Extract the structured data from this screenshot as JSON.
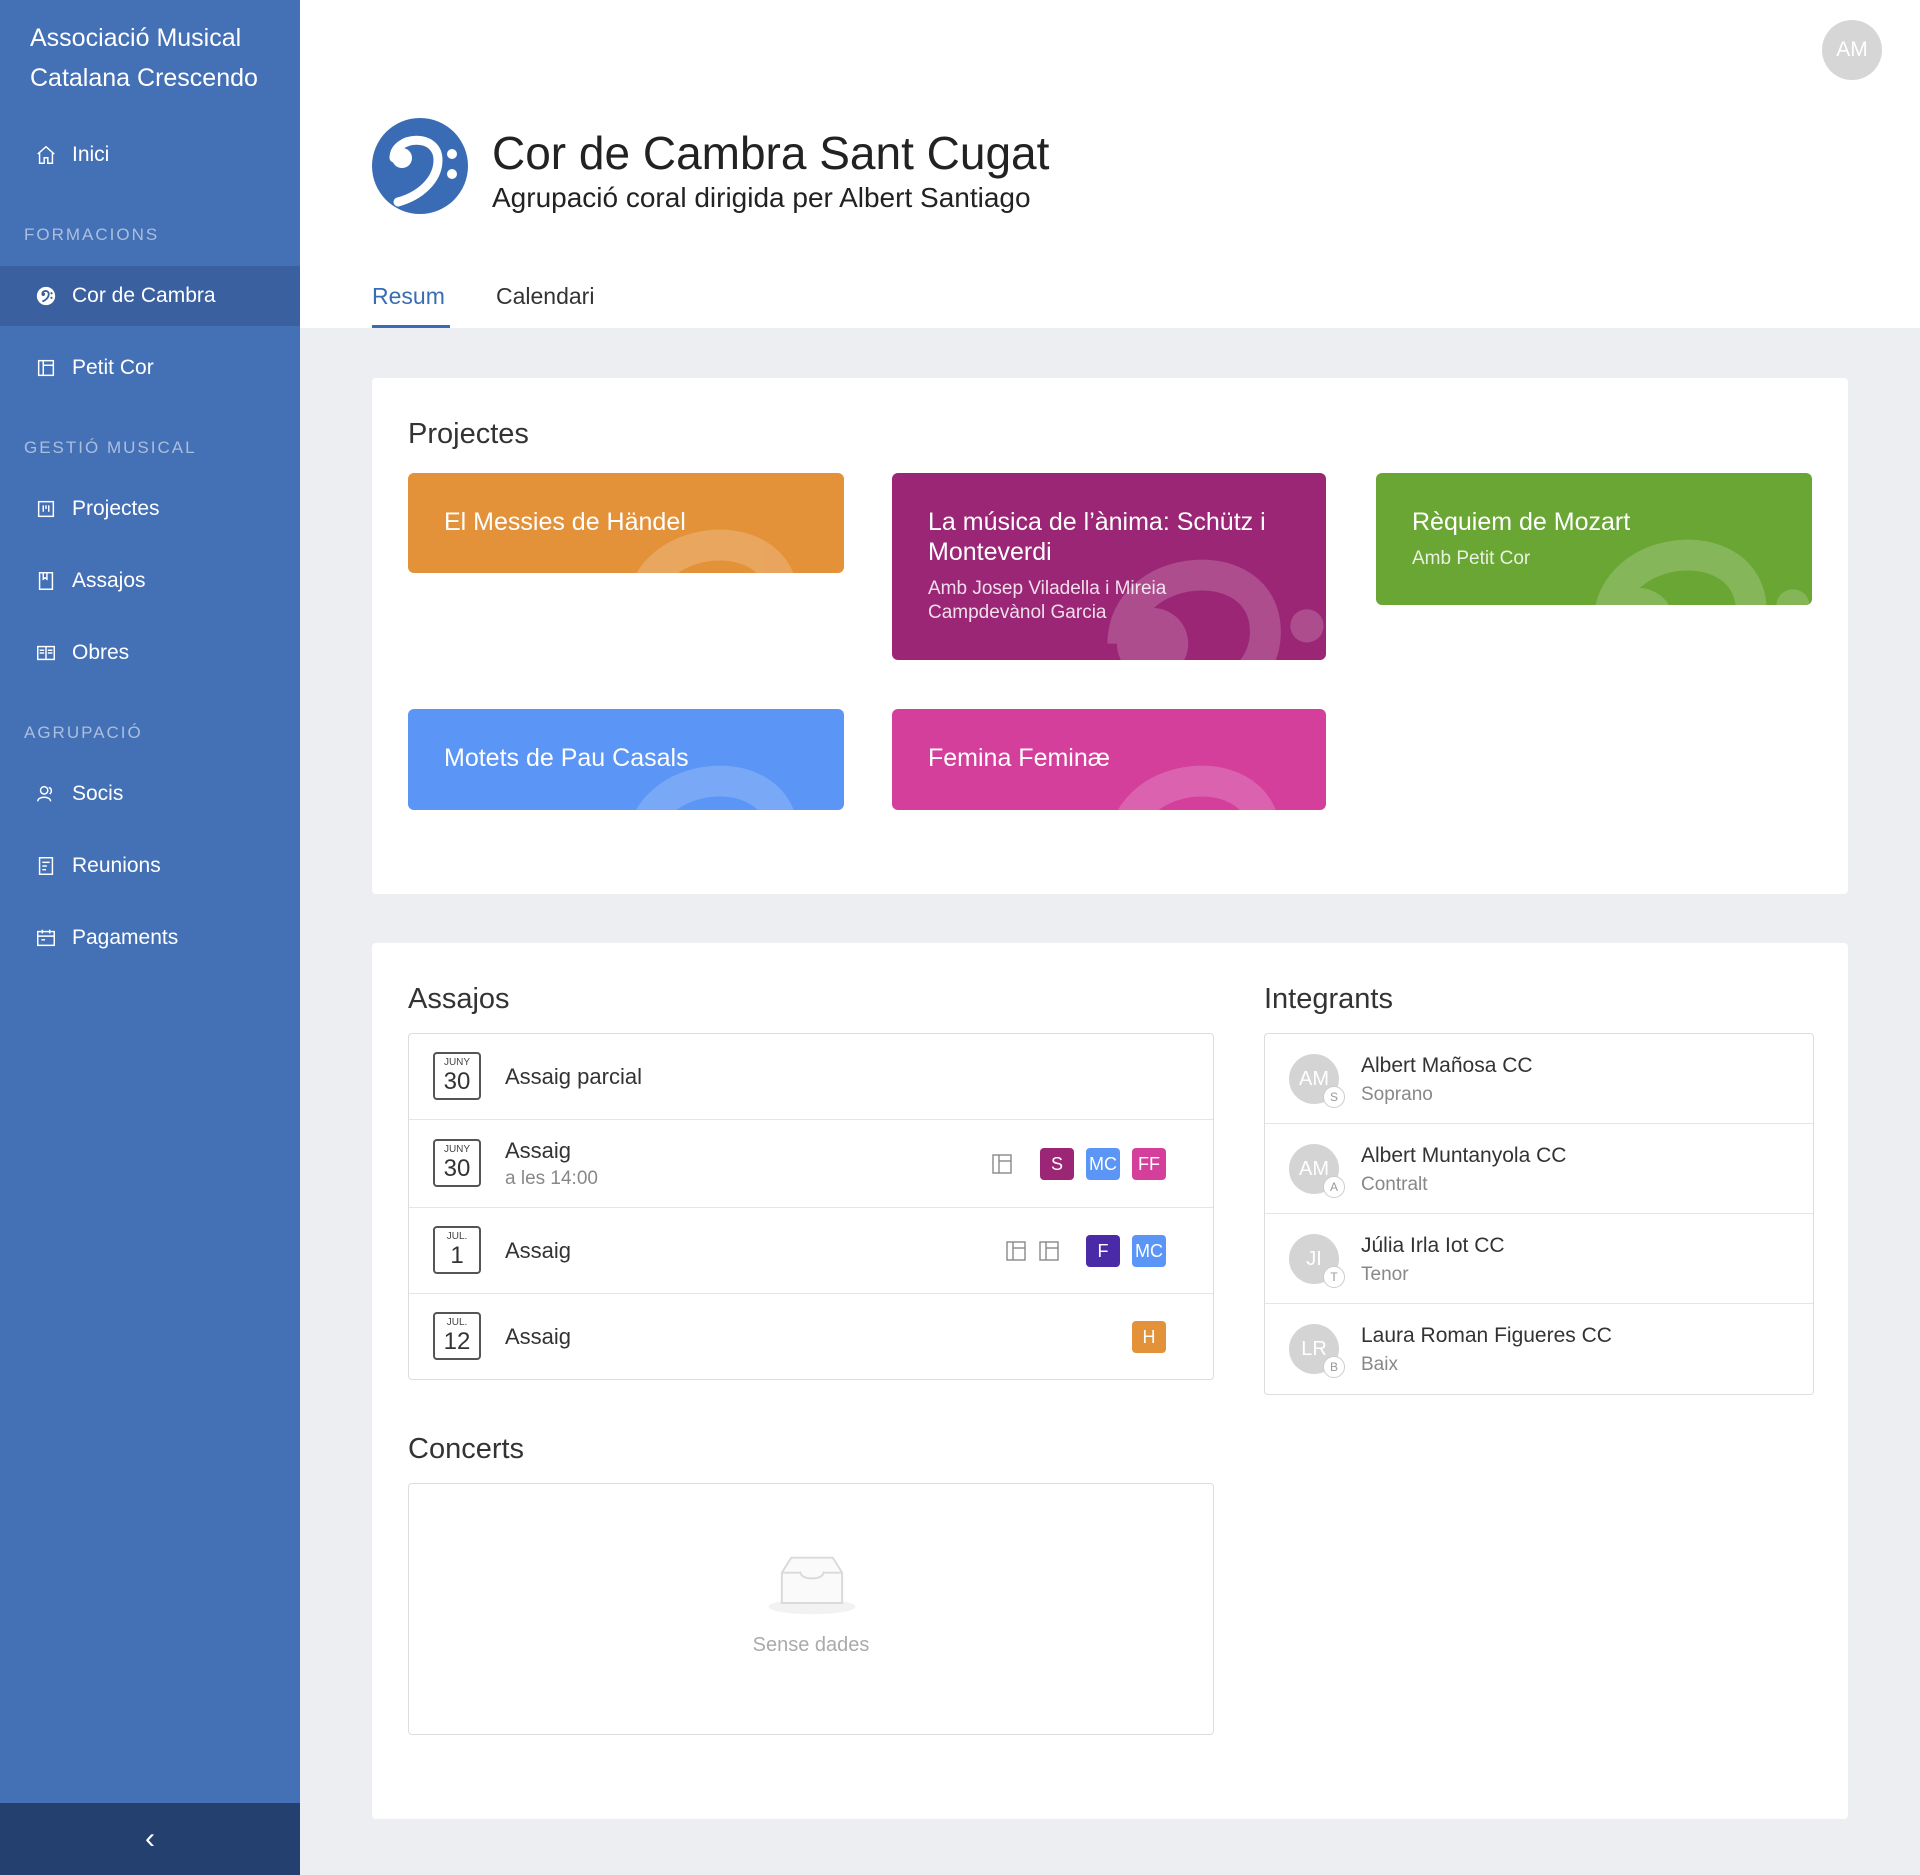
{
  "app": {
    "name": "Associació Musical Catalana Crescendo",
    "user_initials": "AM"
  },
  "sidebar": {
    "home": "Inici",
    "sections": [
      "FORMACIONS",
      "GESTIÓ MUSICAL",
      "AGRUPACIÓ"
    ],
    "formacions": [
      "Cor de Cambra",
      "Petit Cor"
    ],
    "gestio": [
      "Projectes",
      "Assajos",
      "Obres"
    ],
    "agrupacio": [
      "Socis",
      "Reunions",
      "Pagaments"
    ],
    "active": "Cor de Cambra"
  },
  "page": {
    "title": "Cor de Cambra Sant Cugat",
    "subtitle": "Agrupació coral dirigida per Albert Santiago",
    "tabs": [
      "Resum",
      "Calendari"
    ],
    "active_tab": "Resum"
  },
  "projects": {
    "heading": "Projectes",
    "items": [
      {
        "title": "El Messies de Händel",
        "subtitle": "",
        "color": "#e4923a"
      },
      {
        "title": "La música de l’ànima: Schütz i Monteverdi",
        "subtitle": "Amb Josep Viladella i Mireia Campdevànol Garcia",
        "color": "#9b2675"
      },
      {
        "title": "Rèquiem de Mozart",
        "subtitle": "Amb Petit Cor",
        "color": "#6aa634"
      },
      {
        "title": "Motets de Pau Casals",
        "subtitle": "",
        "color": "#5b95f5"
      },
      {
        "title": "Femina Feminæ",
        "subtitle": "",
        "color": "#d43f9c"
      }
    ]
  },
  "assajos": {
    "heading": "Assajos",
    "rows": [
      {
        "month": "JUNY",
        "day": "30",
        "title": "Assaig parcial",
        "sub": "",
        "badges": []
      },
      {
        "month": "JUNY",
        "day": "30",
        "title": "Assaig",
        "sub": "a les 14:00",
        "badges": [
          {
            "t": "S",
            "c": "#9b2675"
          },
          {
            "t": "MC",
            "c": "#5b95f5"
          },
          {
            "t": "FF",
            "c": "#d43f9c"
          }
        ]
      },
      {
        "month": "JUL.",
        "day": "1",
        "title": "Assaig",
        "sub": "",
        "badges": [
          {
            "t": "F",
            "c": "#4b2aa8"
          },
          {
            "t": "MC",
            "c": "#5b95f5"
          }
        ]
      },
      {
        "month": "JUL.",
        "day": "12",
        "title": "Assaig",
        "sub": "",
        "badges": [
          {
            "t": "H",
            "c": "#e4923a"
          }
        ]
      }
    ]
  },
  "concerts": {
    "heading": "Concerts",
    "empty": "Sense dades"
  },
  "integrants": {
    "heading": "Integrants",
    "members": [
      {
        "initials": "AM",
        "voice": "S",
        "name": "Albert Mañosa CC",
        "role": "Soprano"
      },
      {
        "initials": "AM",
        "voice": "A",
        "name": "Albert Muntanyola CC",
        "role": "Contralt"
      },
      {
        "initials": "JI",
        "voice": "T",
        "name": "Júlia Irla Iot CC",
        "role": "Tenor"
      },
      {
        "initials": "LR",
        "voice": "B",
        "name": "Laura Roman Figueres CC",
        "role": "Baix"
      }
    ]
  }
}
